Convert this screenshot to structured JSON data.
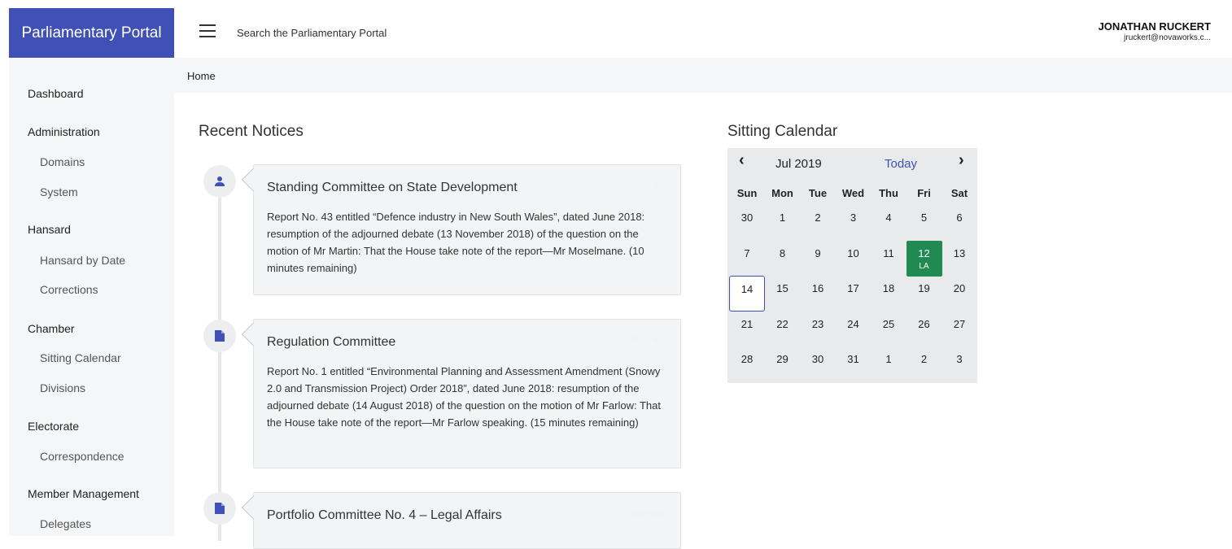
{
  "brand": {
    "title": "Parliamentary Portal"
  },
  "header": {
    "search_placeholder": "Search the Parliamentary Portal",
    "user_name": "JONATHAN RUCKERT",
    "user_email": "jruckert@novaworks.c..."
  },
  "sidebar": {
    "dashboard": "Dashboard",
    "administration": {
      "label": "Administration",
      "domains": "Domains",
      "system": "System"
    },
    "hansard": {
      "label": "Hansard",
      "by_date": "Hansard by Date",
      "corrections": "Corrections"
    },
    "chamber": {
      "label": "Chamber",
      "sitting_calendar": "Sitting Calendar",
      "divisions": "Divisions"
    },
    "electorate": {
      "label": "Electorate",
      "correspondence": "Correspondence"
    },
    "member_management": {
      "label": "Member Management",
      "delegates": "Delegates"
    }
  },
  "breadcrumb": {
    "home": "Home"
  },
  "notices": {
    "title": "Recent Notices",
    "items": [
      {
        "icon": "person-icon",
        "title": "Standing Committee on State Development",
        "time": "1 day ago",
        "body": "Report No. 43 entitled “Defence industry in New South Wales”, dated June 2018: resumption of the adjourned debate (13 November 2018) of the question on the motion of Mr Martin: That the House take note of the report—Mr Moselmane. (10 minutes remaining)"
      },
      {
        "icon": "document-icon",
        "title": "Regulation Committee",
        "time": "2 days ago",
        "body": "Report No. 1 entitled “Environmental Planning and Assessment Amendment (Snowy 2.0 and Transmission Project) Order 2018”, dated June 2018: resumption of the adjourned debate (14 August 2018) of the question on the motion of Mr Farlow: That the House take note of the report—Mr Farlow speaking. (15 minutes remaining)"
      },
      {
        "icon": "document-icon",
        "title": "Portfolio Committee No. 4 – Legal Affairs",
        "time": "3 days ago",
        "body": ""
      }
    ]
  },
  "calendar": {
    "title": "Sitting Calendar",
    "month_label": "Jul 2019",
    "today_label": "Today",
    "prev_icon": "chevron-left-icon",
    "next_icon": "chevron-right-icon",
    "weekdays": [
      "Sun",
      "Mon",
      "Tue",
      "Wed",
      "Thu",
      "Fri",
      "Sat"
    ],
    "weeks": [
      [
        "30",
        "1",
        "2",
        "3",
        "4",
        "5",
        "6"
      ],
      [
        "7",
        "8",
        "9",
        "10",
        "11",
        "12",
        "13"
      ],
      [
        "14",
        "15",
        "16",
        "17",
        "18",
        "19",
        "20"
      ],
      [
        "21",
        "22",
        "23",
        "24",
        "25",
        "26",
        "27"
      ],
      [
        "28",
        "29",
        "30",
        "31",
        "1",
        "2",
        "3"
      ]
    ],
    "selected_day": "12",
    "selected_label": "LA",
    "today_day": "14",
    "selected_color": "#218a52",
    "accent_color": "#3f51b5"
  }
}
